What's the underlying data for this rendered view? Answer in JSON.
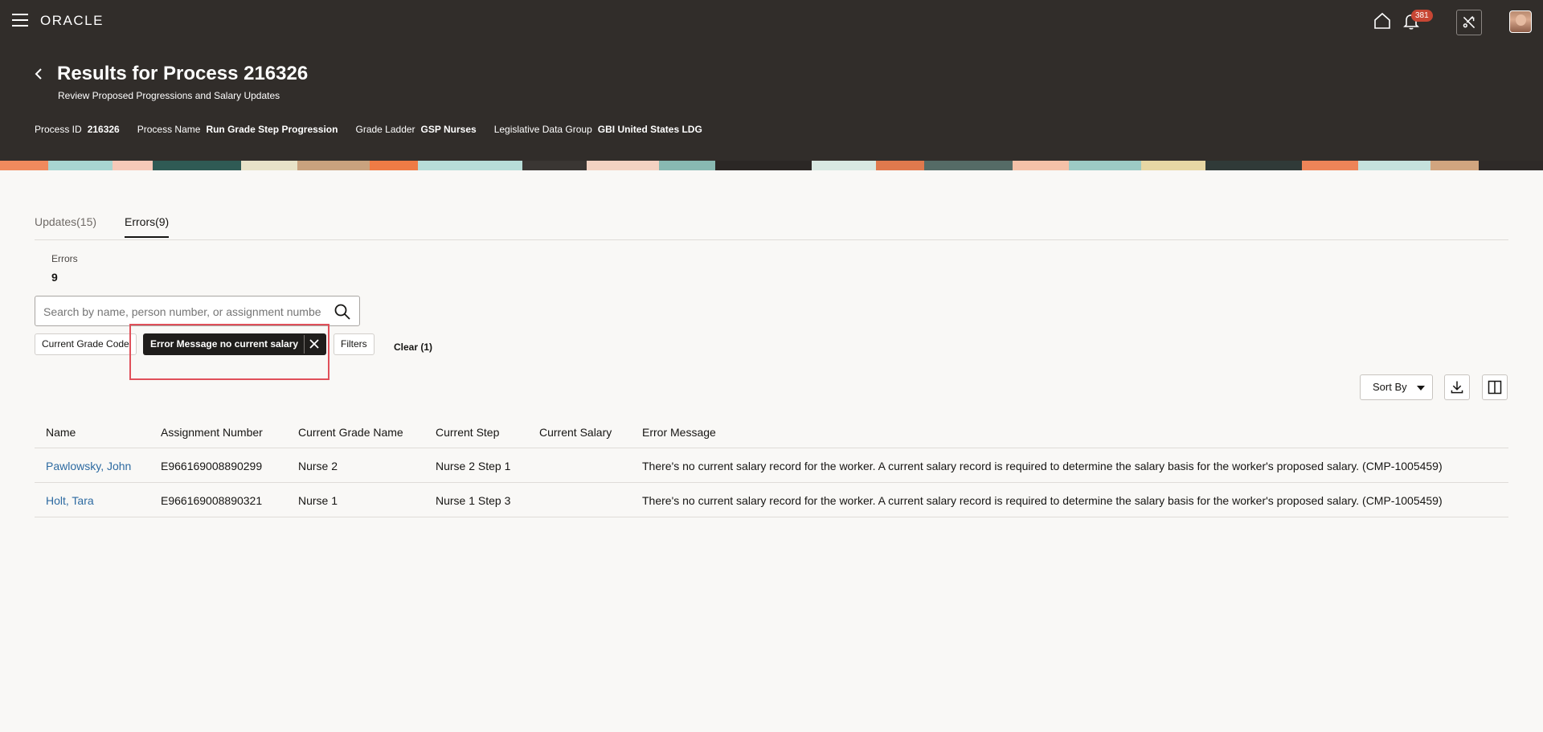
{
  "app": {
    "logo": "ORACLE",
    "notifications_count": "381",
    "icons": {
      "menu": "hamburger-menu-icon",
      "home": "home-icon",
      "bell": "bell-icon",
      "tools": "accessibility-icon",
      "back": "chevron-left-icon",
      "search": "search-icon",
      "close": "close-icon",
      "download": "download-icon",
      "columns": "columns-panel-icon"
    }
  },
  "page": {
    "title": "Results for Process 216326",
    "subtitle": "Review Proposed Progressions and Salary Updates",
    "meta": [
      {
        "label": "Process ID",
        "value": "216326"
      },
      {
        "label": "Process Name",
        "value": "Run Grade Step Progression"
      },
      {
        "label": "Grade Ladder",
        "value": "GSP Nurses"
      },
      {
        "label": "Legislative Data Group",
        "value": "GBI United States LDG"
      }
    ]
  },
  "tabs": [
    {
      "label": "Updates(15)",
      "active": false
    },
    {
      "label": "Errors(9)",
      "active": true
    }
  ],
  "summary": {
    "label": "Errors",
    "count": "9"
  },
  "search": {
    "placeholder": "Search by name, person number, or assignment number",
    "value": ""
  },
  "filters": {
    "chip_grade": "Current Grade Code",
    "chip_active": "Error Message no current salary",
    "chip_filters": "Filters",
    "clear": "Clear (1)"
  },
  "toolbar": {
    "sort_label": "Sort By"
  },
  "table": {
    "headers": {
      "name": "Name",
      "assignment": "Assignment Number",
      "grade": "Current Grade Name",
      "step": "Current Step",
      "salary": "Current Salary",
      "error": "Error Message"
    },
    "rows": [
      {
        "name": "Pawlowsky, John",
        "assignment": "E966169008890299",
        "grade": "Nurse 2",
        "step": "Nurse 2 Step 1",
        "salary": "",
        "error": "There's no current salary record for the worker. A current salary record is required to determine the salary basis for the worker's proposed salary. (CMP-1005459)"
      },
      {
        "name": "Holt, Tara",
        "assignment": "E966169008890321",
        "grade": "Nurse 1",
        "step": "Nurse 1 Step 3",
        "salary": "",
        "error": "There's no current salary record for the worker. A current salary record is required to determine the salary basis for the worker's proposed salary. (CMP-1005459)"
      }
    ]
  },
  "colors": {
    "header_bg": "#312d2a",
    "link": "#2d6aa1",
    "badge": "#c74634",
    "highlight": "#e0505a"
  }
}
